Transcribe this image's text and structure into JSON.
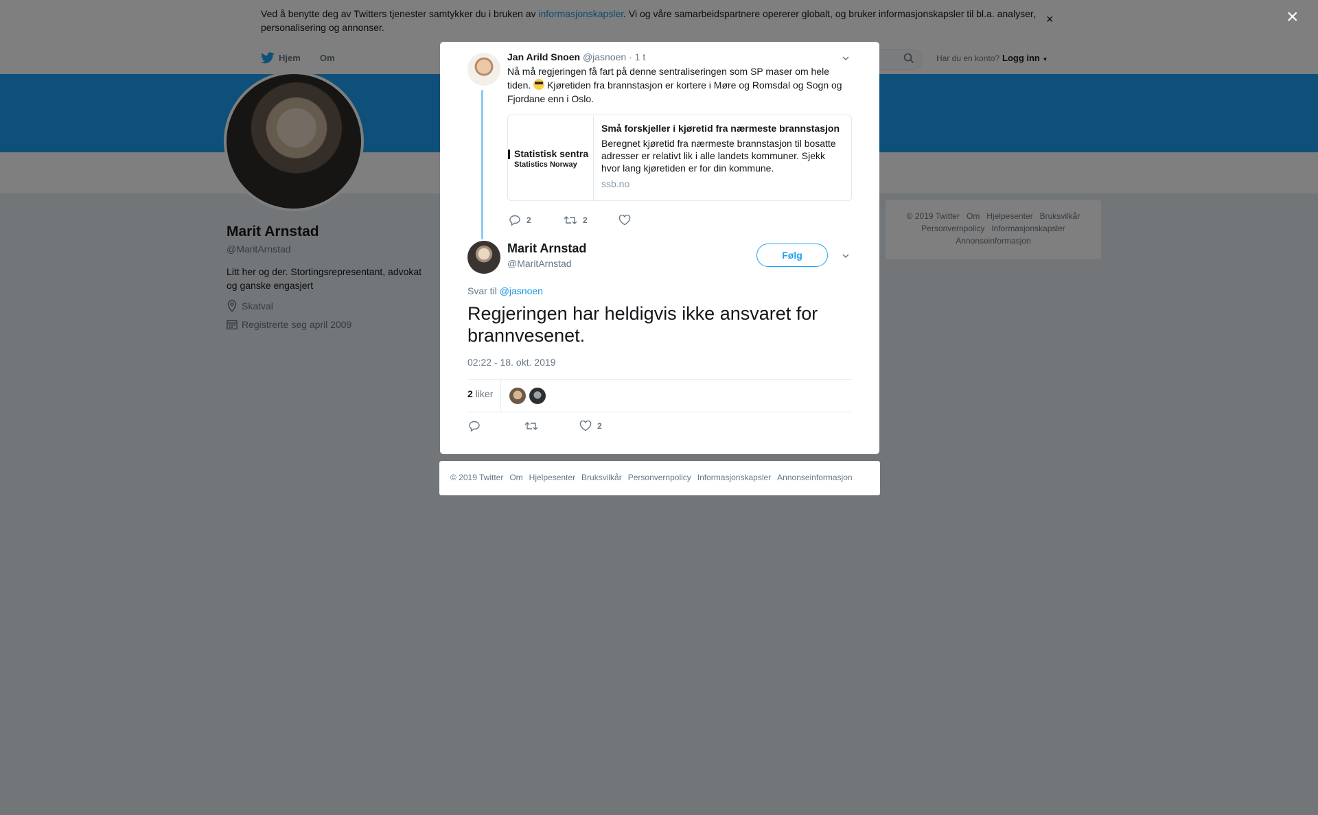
{
  "cookie": {
    "text_before": "Ved å benytte deg av Twitters tjenester samtykker du i bruken av ",
    "link": "informasjonskapsler",
    "text_after": ". Vi og våre samarbeidspartnere opererer globalt, og bruker informasjonskapsler til bl.a. analyser, personalisering og annonser.",
    "close": "×"
  },
  "nav": {
    "home": "Hjem",
    "about": "Om",
    "account_question": "Har du en konto?",
    "login": "Logg inn"
  },
  "profile": {
    "name": "Marit Arnstad",
    "handle": "@MaritArnstad",
    "bio": "Litt her og der. Stortingsrepresentant, advokat og ganske engasjert",
    "location": "Skatval",
    "joined": "Registrerte seg april 2009"
  },
  "side_footer": [
    "© 2019 Twitter",
    "Om",
    "Hjelpesenter",
    "Bruksvilkår",
    "Personvernpolicy",
    "Informasjonskapsler",
    "Annonseinformasjon"
  ],
  "overlay": {
    "close": "×"
  },
  "parent_tweet": {
    "name": "Jan Arild Snoen",
    "handle": "@jasnoen",
    "time": "· 1 t",
    "text_1": "Nå må regjeringen få fart på denne sentraliseringen som SP maser om hele tiden. ",
    "text_2": " Kjøretiden fra brannstasjon er kortere i Møre og Romsdal og Sogn og Fjordane enn i Oslo.",
    "card": {
      "logo_line1": "Statistisk sentra",
      "logo_line2": "Statistics Norway",
      "title": "Små forskjeller i kjøretid fra nærmeste brannstasjon",
      "description": "Beregnet kjøretid fra nærmeste brannstasjon til bosatte adresser er relativt lik i alle landets kommuner. Sjekk hvor lang kjøretiden er for din kommune.",
      "domain": "ssb.no"
    },
    "replies": "2",
    "retweets": "2",
    "likes": ""
  },
  "main_tweet": {
    "name": "Marit Arnstad",
    "handle": "@MaritArnstad",
    "follow": "Følg",
    "reply_prefix": "Svar til ",
    "reply_handle": "@jasnoen",
    "text": "Regjeringen har heldigvis ikke ansvaret for brannvesenet.",
    "timestamp": "02:22 - 18. okt. 2019",
    "likes_count": "2",
    "likes_label": " liker",
    "action_likes": "2"
  },
  "modal_footer": [
    "© 2019 Twitter",
    "Om",
    "Hjelpesenter",
    "Bruksvilkår",
    "Personvernpolicy",
    "Informasjonskapsler",
    "Annonseinformasjon"
  ],
  "colors": {
    "brand": "#1da1f2",
    "link": "#1b95e0",
    "secondary_text": "#657786",
    "overlay": "rgba(0,0,0,0.5)"
  }
}
